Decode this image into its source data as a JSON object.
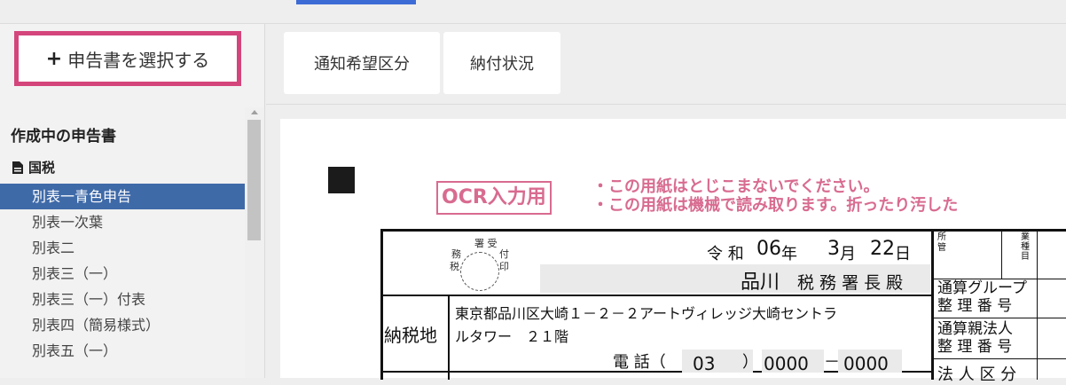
{
  "select_button": {
    "plus": "+",
    "label": "申告書を選択する"
  },
  "sidebar": {
    "section_title": "作成中の申告書",
    "subsection": "国税",
    "items": [
      {
        "label": "別表一青色申告",
        "active": true
      },
      {
        "label": "別表一次葉",
        "active": false
      },
      {
        "label": "別表二",
        "active": false
      },
      {
        "label": "別表三（一）",
        "active": false
      },
      {
        "label": "別表三（一）付表",
        "active": false
      },
      {
        "label": "別表四（簡易様式）",
        "active": false
      },
      {
        "label": "別表五（一）",
        "active": false
      }
    ]
  },
  "tabs": [
    {
      "label": "通知希望区分"
    },
    {
      "label": "納付状況"
    }
  ],
  "form": {
    "ocr_label": "OCR入力用",
    "notice_line1": "・この用紙はとじこまないでください。",
    "notice_line2": "・この用紙は機械で読み取ります。折ったり汚した",
    "stamp": {
      "top": "署 受",
      "left": "務",
      "right": "付",
      "bottom_left": "税",
      "bottom_right": "印"
    },
    "date": {
      "era": "令 和",
      "year": "06",
      "year_unit": "年",
      "month": "3",
      "month_unit": "月",
      "day": "22",
      "day_unit": "日"
    },
    "office": {
      "name": "品川",
      "suffix": "税 務 署 長 殿"
    },
    "address_label": "納税地",
    "address_line1": "東京都品川区大崎１－２－２アートヴィレッジ大崎セントラ",
    "address_line2": "ルタワー　２１階",
    "phone": {
      "label": "電 話（",
      "area": "03",
      "close": "）",
      "part1": "0000",
      "dash": "－",
      "part2": "0000"
    },
    "right_labels": {
      "jurisdiction": "所\n管",
      "industry": "業\n種\n目",
      "group_number_1": "通算グループ",
      "group_number_2": "整 理 番 号",
      "parent_number_1": "通算親法人",
      "parent_number_2": "整 理 番 号",
      "corp_class": "法 人 区 分"
    }
  },
  "colors": {
    "accent_pink": "#d4457c",
    "ocr_pink": "#d86b90",
    "active_blue": "#3f6aa8",
    "top_tab_blue": "#3d6bd6"
  }
}
